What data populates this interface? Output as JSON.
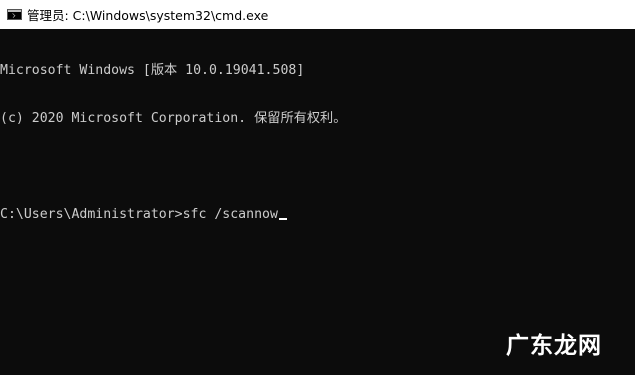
{
  "window": {
    "title": "管理员: C:\\Windows\\system32\\cmd.exe",
    "icon": "cmd-icon"
  },
  "console": {
    "lines": [
      "Microsoft Windows [版本 10.0.19041.508]",
      "(c) 2020 Microsoft Corporation. 保留所有权利。",
      "",
      "C:\\Users\\Administrator>sfc /scannow"
    ],
    "text_color": "#cccccc",
    "background": "#0c0c0c"
  },
  "watermark": {
    "text": "广东龙网"
  }
}
